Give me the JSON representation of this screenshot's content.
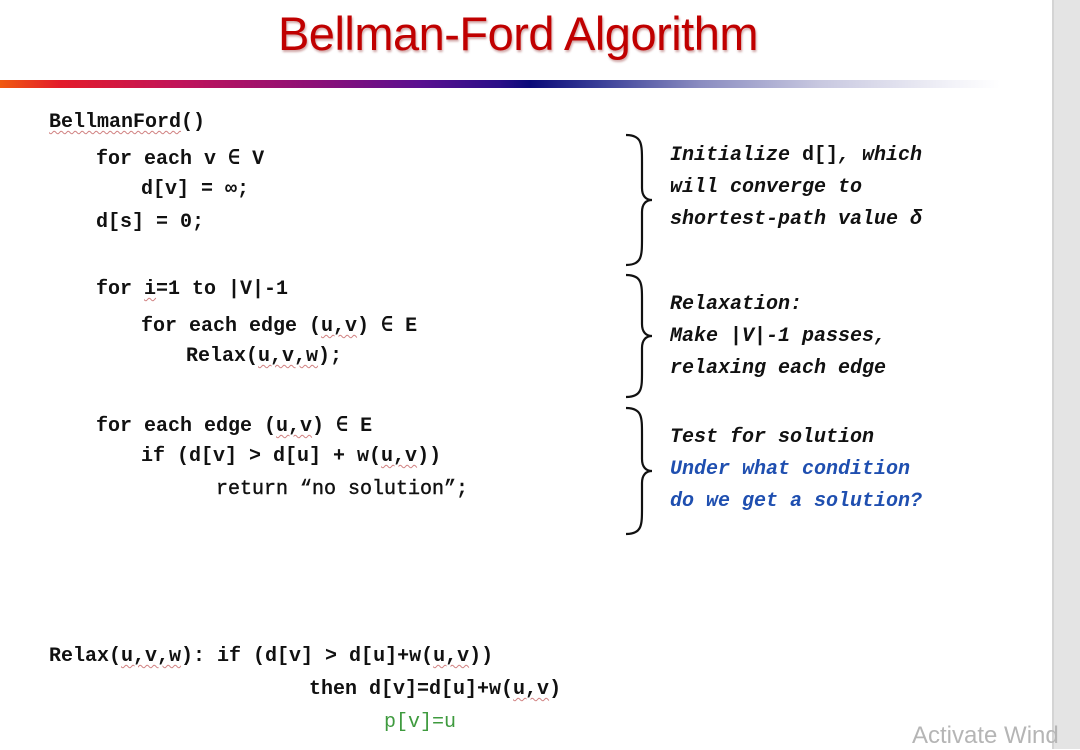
{
  "title": "Bellman-Ford Algorithm",
  "algorithm": {
    "signature_name": "BellmanFord",
    "signature_parens": "()",
    "init": {
      "line1": "for each v ∈ V",
      "line2": "d[v] = ∞;",
      "line3": "d[s] = 0;"
    },
    "relax_loop": {
      "line1_prefix": "for ",
      "line1_var": "i",
      "line1_suffix": "=1 to |V|-1",
      "line2_prefix": "for each edge (",
      "line2_args": "u,v",
      "line2_suffix": ") ∈ E",
      "line3_prefix": "Relax(",
      "line3_args": "u,v,w",
      "line3_suffix": ");"
    },
    "check_loop": {
      "line1_prefix": "for each edge (",
      "line1_args": "u,v",
      "line1_suffix": ") ∈ E",
      "line2_prefix": "if (d[v] > d[u] + w(",
      "line2_args": "u,v",
      "line2_suffix": "))",
      "line3": "return “no solution”;"
    }
  },
  "annotations": {
    "init": {
      "line1_italic": "Initialize ",
      "line1_plain": "d[]",
      "line1_tail": ", which",
      "line2": "will converge to",
      "line3": "shortest-path value δ"
    },
    "relaxation": {
      "line1": "Relaxation:",
      "line2": "Make |V|-1 passes,",
      "line3": "relaxing each edge"
    },
    "test": {
      "line1": "Test for solution",
      "line2": "Under what condition",
      "line3": "do we get a solution?"
    }
  },
  "relax_definition": {
    "line1_prefix": "Relax(",
    "line1_args": "u,v,w",
    "line1_mid": "): if (d[v] > d[u]+w(",
    "line1_args2": "u,v",
    "line1_suffix": "))",
    "line2_prefix": "then d[v]=d[u]+w(",
    "line2_args": "u,v",
    "line2_suffix": ")",
    "line3": "p[v]=u"
  },
  "watermark": "Activate Wind",
  "colors": {
    "title": "#c00000",
    "question": "#1f4fb0",
    "predecessor": "#3e9a3e"
  }
}
